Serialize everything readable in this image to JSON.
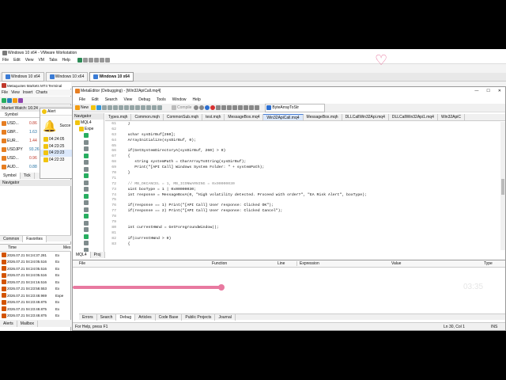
{
  "vmware": {
    "title": "Windows 10 x64 - VMware Workstation",
    "menu": [
      "File",
      "Edit",
      "View",
      "VM",
      "Tabs",
      "Help"
    ],
    "tabs": [
      "Windows 10 x64",
      "Windows 10 x64",
      "Windows 10 x64"
    ]
  },
  "mt5": {
    "title": "Metaquotes Markets MT4 Terminal",
    "menu": [
      "File",
      "View",
      "Insert",
      "Charts"
    ],
    "market_watch_title": "Market Watch: 16:24",
    "symbol_header": "Symbol",
    "symbols": [
      {
        "name": "USD...",
        "value": "0.86"
      },
      {
        "name": "GBP...",
        "value": "1.63"
      },
      {
        "name": "EUR...",
        "value": "1.44"
      },
      {
        "name": "USDJPY",
        "value": "93.26"
      },
      {
        "name": "USD...",
        "value": "0.96"
      },
      {
        "name": "AUD...",
        "value": "0.88"
      }
    ],
    "symbol_tabs": [
      "Symbol",
      "Tick"
    ],
    "navigator_title": "Navigator",
    "nav_tabs": [
      "Common",
      "Favorites"
    ],
    "log_headers": [
      "Time",
      "Mes"
    ],
    "log_rows": [
      {
        "time": "2026.07.21 04:24:37.281",
        "msg": "Ex"
      },
      {
        "time": "2026.07.21 04:24:05.516",
        "msg": "Ex"
      },
      {
        "time": "2026.07.21 04:24:05.516",
        "msg": "Ex"
      },
      {
        "time": "2026.07.21 04:24:05.516",
        "msg": "Ex"
      },
      {
        "time": "2026.07.21 04:24:16.516",
        "msg": "Ex"
      },
      {
        "time": "2026.07.21 04:23:58.553",
        "msg": "Ex"
      },
      {
        "time": "2026.07.21 04:23:48.969",
        "msg": "Expe"
      },
      {
        "time": "2026.07.21 04:23:48.875",
        "msg": "Ex"
      },
      {
        "time": "2026.07.21 04:23:48.875",
        "msg": "Ex"
      },
      {
        "time": "2026.07.21 04:23:48.875",
        "msg": "Ex"
      }
    ],
    "bottom_tabs": [
      "Alerts",
      "Mailbox"
    ]
  },
  "alert": {
    "title": "Alert",
    "status": "Succe",
    "times": [
      "04:24:05",
      "04:23:25",
      "04:23:23",
      "04:22:33"
    ]
  },
  "metaeditor": {
    "title": "MetaEditor (Debugging) - [Win32ApiCall.mq4]",
    "menu": [
      "File",
      "Edit",
      "Search",
      "View",
      "Debug",
      "Tools",
      "Window",
      "Help"
    ],
    "toolbar": {
      "new_label": "New",
      "compile_label": "Compile",
      "search_value": "ByteArrayToStr"
    },
    "tabs": [
      "Types.mqh",
      "Common.mqh",
      "CommonSub.mqh",
      "test.mqh",
      "MessageBox.mq4",
      "Win32ApiCall.mq4",
      "MessageBox.mqh",
      "DLLCallWin32Api.mq4",
      "DLLCallWin32Api1.mq4",
      "Win32ApiC"
    ],
    "navigator_title": "Navigator",
    "navigator_root": "MQL4",
    "navigator_sub": "Expe",
    "nav_tabs": [
      "MQL4",
      "Proj"
    ],
    "line_numbers": [
      "61",
      "62",
      "63",
      "64",
      "65",
      "66",
      "67",
      "68",
      "69",
      "70",
      "71",
      "72",
      "73",
      "74",
      "75",
      "76",
      "77",
      "78",
      "79",
      "80",
      "81",
      "82",
      "83"
    ],
    "code_lines": [
      "   }",
      "",
      "   uchar sysDirBuf[260];",
      "   ArrayInitialize(sysDirBuf, 0);",
      "",
      "   if(GetSystemDirectoryA(sysDirBuf, 260) > 0)",
      "   {",
      "      string systemPath = CharArrayToString(sysDirBuf);",
      "      Print(\"[API Call] Windows System Folder: \" + systemPath);",
      "   }",
      "",
      "   // MB_OKCANCEL = 1, MB_ICONWARNING = 0x00000030",
      "   uint boxType = 1 | 0x00000030;",
      "   int response = MessageBoxA(0, \"High volatility detected. Proceed with order?\", \"EA Risk Alert\", boxType);",
      "",
      "   if(response == 1) Print(\"[API Call] User response: Clicked OK\");",
      "   if(response == 2) Print(\"[API Call] User response: Clicked Cancel\");",
      "",
      "",
      "   int currentHWnd = GetForegroundWindow();",
      "",
      "   if(currentHWnd > 0)",
      "   {"
    ],
    "debug_headers": {
      "file": "File",
      "function": "Function",
      "line": "Line",
      "expression": "Expression",
      "value": "Value",
      "type": "Type"
    },
    "bottom_tabs": [
      "Errors",
      "Search",
      "Debug",
      "Articles",
      "Code Base",
      "Public Projects",
      "Journal"
    ],
    "status_help": "For Help, press F1",
    "status_pos": "Ln 30, Col 1",
    "status_mode": "INS"
  },
  "overlay": {
    "time_text": "03:35"
  },
  "colors": {
    "accent": "#e879a0",
    "editor_bg": "#ffffff",
    "window_chrome": "#f0f0f0",
    "active_tab": "#dbe8fb"
  }
}
